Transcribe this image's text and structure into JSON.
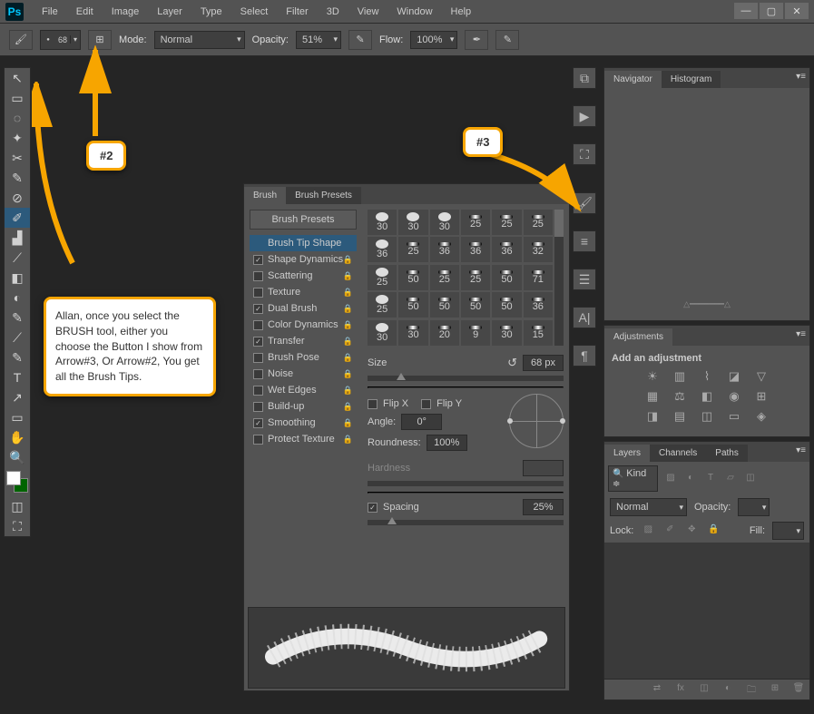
{
  "logo": "Ps",
  "menu": [
    "File",
    "Edit",
    "Image",
    "Layer",
    "Type",
    "Select",
    "Filter",
    "3D",
    "View",
    "Window",
    "Help"
  ],
  "winctrl": {
    "min": "—",
    "max": "▢",
    "close": "✕"
  },
  "options": {
    "brushsize": "68",
    "mode_label": "Mode:",
    "mode_value": "Normal",
    "opacity_label": "Opacity:",
    "opacity_value": "51%",
    "flow_label": "Flow:",
    "flow_value": "100%"
  },
  "tools": [
    "↖",
    "▭",
    "◌",
    "✦",
    "✂",
    "✎",
    "⊘",
    "✐",
    "▟",
    "⟋",
    "◧",
    "◐",
    "⟋",
    "T",
    "↗",
    "✋",
    "🔍"
  ],
  "brush_panel": {
    "tabs": [
      "Brush",
      "Brush Presets"
    ],
    "presets_btn": "Brush Presets",
    "options": [
      {
        "label": "Brush Tip Shape",
        "chk": null,
        "sel": true,
        "lock": false
      },
      {
        "label": "Shape Dynamics",
        "chk": true,
        "lock": true
      },
      {
        "label": "Scattering",
        "chk": false,
        "lock": true
      },
      {
        "label": "Texture",
        "chk": false,
        "lock": true
      },
      {
        "label": "Dual Brush",
        "chk": true,
        "lock": true
      },
      {
        "label": "Color Dynamics",
        "chk": false,
        "lock": true
      },
      {
        "label": "Transfer",
        "chk": true,
        "lock": true
      },
      {
        "label": "Brush Pose",
        "chk": false,
        "lock": true
      },
      {
        "label": "Noise",
        "chk": false,
        "lock": true
      },
      {
        "label": "Wet Edges",
        "chk": false,
        "lock": true
      },
      {
        "label": "Build-up",
        "chk": false,
        "lock": true
      },
      {
        "label": "Smoothing",
        "chk": true,
        "lock": true
      },
      {
        "label": "Protect Texture",
        "chk": false,
        "lock": true
      }
    ],
    "tips": [
      {
        "v": "30",
        "t": "soft"
      },
      {
        "v": "30",
        "t": "hard"
      },
      {
        "v": "30",
        "t": "hard"
      },
      {
        "v": "25",
        "t": "line"
      },
      {
        "v": "25",
        "t": "line"
      },
      {
        "v": "25",
        "t": "line"
      },
      {
        "v": "36",
        "t": "soft"
      },
      {
        "v": "25",
        "t": "line"
      },
      {
        "v": "36",
        "t": "line"
      },
      {
        "v": "36",
        "t": "line"
      },
      {
        "v": "36",
        "t": "line"
      },
      {
        "v": "32",
        "t": "line"
      },
      {
        "v": "25",
        "t": "soft"
      },
      {
        "v": "50",
        "t": "line"
      },
      {
        "v": "25",
        "t": "line"
      },
      {
        "v": "25",
        "t": "line"
      },
      {
        "v": "50",
        "t": "line"
      },
      {
        "v": "71",
        "t": "line"
      },
      {
        "v": "25",
        "t": "soft"
      },
      {
        "v": "50",
        "t": "line"
      },
      {
        "v": "50",
        "t": "line"
      },
      {
        "v": "50",
        "t": "line"
      },
      {
        "v": "50",
        "t": "line"
      },
      {
        "v": "36",
        "t": "line"
      },
      {
        "v": "30",
        "t": "soft"
      },
      {
        "v": "30",
        "t": "line"
      },
      {
        "v": "20",
        "t": "line"
      },
      {
        "v": "9",
        "t": "line"
      },
      {
        "v": "30",
        "t": "line"
      },
      {
        "v": "15",
        "t": "line"
      }
    ],
    "size_label": "Size",
    "size_value": "68 px",
    "flipx": "Flip X",
    "flipy": "Flip Y",
    "angle_label": "Angle:",
    "angle_value": "0°",
    "roundness_label": "Roundness:",
    "roundness_value": "100%",
    "hardness_label": "Hardness",
    "spacing_label": "Spacing",
    "spacing_value": "25%"
  },
  "right": {
    "nav_tabs": [
      "Navigator",
      "Histogram"
    ],
    "adj_tab": "Adjustments",
    "adj_title": "Add an adjustment",
    "layers_tabs": [
      "Layers",
      "Channels",
      "Paths"
    ],
    "kind": "Kind",
    "blend": "Normal",
    "opacity_lbl": "Opacity:",
    "lock_lbl": "Lock:",
    "fill_lbl": "Fill:"
  },
  "annotations": {
    "badge2": "#2",
    "badge3": "#3",
    "note": "Allan, once you select the BRUSH tool, either you choose the Button I show from Arrow#3, Or Arrow#2, You get all the Brush Tips."
  }
}
